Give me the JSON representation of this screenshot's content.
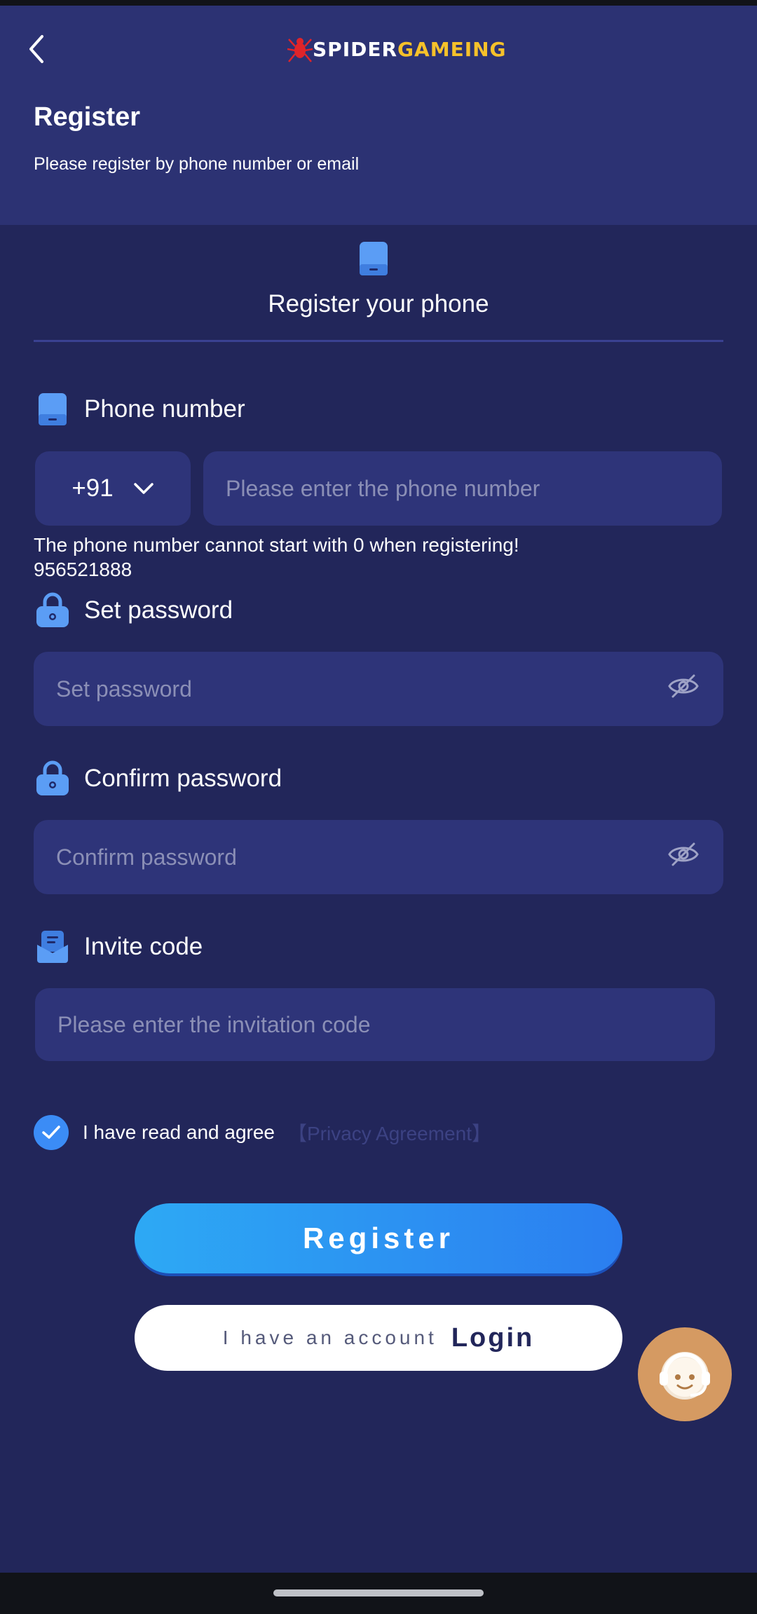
{
  "header": {
    "logo": {
      "part1": "SPIDER",
      "part2": "GAMEING"
    },
    "title": "Register",
    "subtitle": "Please register by phone number or email"
  },
  "tab": {
    "label": "Register your phone",
    "icon": "phone-icon"
  },
  "phone": {
    "label": "Phone number",
    "country_code": "+91",
    "placeholder": "Please enter the phone number",
    "hint": "The phone number cannot start with 0 when registering!",
    "hint_number": "956521888"
  },
  "password": {
    "label": "Set password",
    "placeholder": "Set password"
  },
  "confirm_password": {
    "label": "Confirm password",
    "placeholder": "Confirm password"
  },
  "invite": {
    "label": "Invite code",
    "placeholder": "Please enter the invitation code"
  },
  "agreement": {
    "text": "I have read and agree",
    "link": "【Privacy Agreement】",
    "checked": true
  },
  "buttons": {
    "register": "Register",
    "login_prefix": "I have an account",
    "login": "Login"
  },
  "colors": {
    "background": "#22265a",
    "header": "#2c3273",
    "input": "#2e3479",
    "accent": "#3b8cf6",
    "logo_yellow": "#f6c12a",
    "support": "#d59a62"
  }
}
